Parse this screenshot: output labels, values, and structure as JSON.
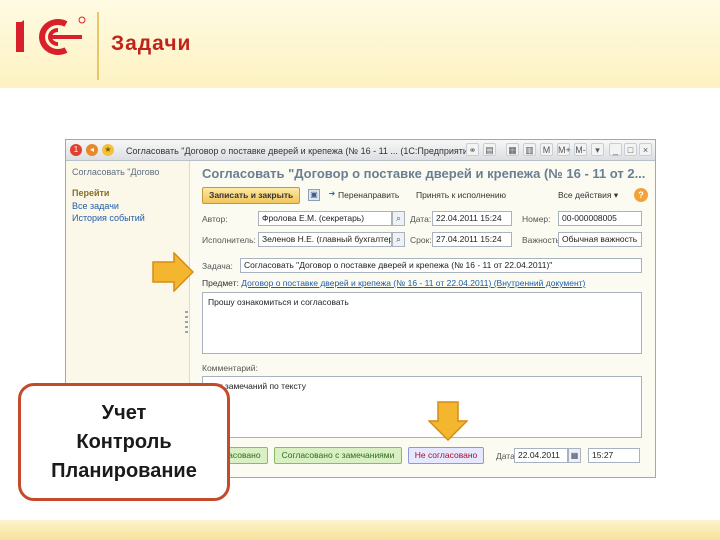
{
  "slide": {
    "title": "Задачи",
    "callout_lines": [
      "Учет",
      "Контроль",
      "Планирование"
    ],
    "colors": {
      "title": "#c0231a",
      "logo": "#d8202b",
      "callout_border": "#c34a2a",
      "arrow": "#f4b52f"
    }
  },
  "window": {
    "title_text": "Согласовать \"Договор о поставке дверей и крепежа (№ 16 - 11 ... (1С:Предприятие)",
    "title_buttons": [
      "M",
      "M+",
      "M-",
      "▾",
      "_",
      "□",
      "×"
    ]
  },
  "sidebar": {
    "title": "Согласовать \"Догово",
    "section": "Перейти",
    "links": [
      "Все задачи",
      "История событий"
    ]
  },
  "form": {
    "title": "Согласовать \"Договор о поставке дверей и крепежа (№ 16 - 11 от 2...",
    "toolbar": {
      "save_close": "Записать и закрыть",
      "redirect": "Перенаправить",
      "accept": "Принять к исполнению",
      "all_actions": "Все действия ▾",
      "help": "?"
    },
    "fields": {
      "author_label": "Автор:",
      "author_value": "Фролова Е.М. (секретарь)",
      "date_label": "Дата:",
      "date_value": "22.04.2011 15:24",
      "number_label": "Номер:",
      "number_value": "00-000008005",
      "executor_label": "Исполнитель:",
      "executor_value": "Зеленов Н.Е. (главный бухгалтер)",
      "deadline_label": "Срок:",
      "deadline_value": "27.04.2011 15:24",
      "importance_label": "Важность:",
      "importance_value": "Обычная важность",
      "task_label": "Задача:",
      "task_value": "Согласовать \"Договор о поставке дверей и крепежа (№ 16 - 11 от 22.04.2011)\"",
      "subject_label": "Предмет:",
      "subject_link": "Договор о поставке дверей и крепежа (№ 16 - 11 от 22.04.2011) (Внутренний документ)",
      "description": "Прошу ознакомиться и согласовать",
      "comment_label": "Комментарий:",
      "comment_value": "Нет замечаний по тексту"
    },
    "bottom": {
      "approved": "Согласовано",
      "approved_remarks": "Согласовано с замечаниями",
      "not_approved": "Не согласовано",
      "date_label": "Дата:",
      "date_value": "22.04.2011",
      "time_value": "15:27"
    }
  }
}
